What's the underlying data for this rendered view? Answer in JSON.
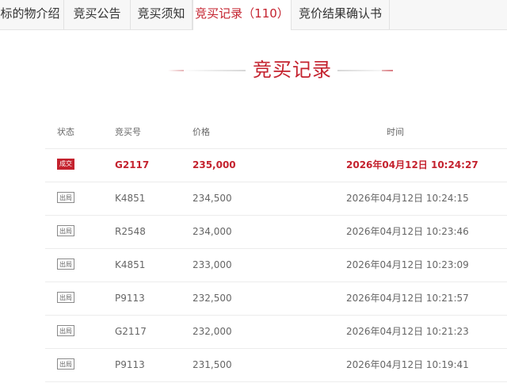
{
  "tabs": [
    {
      "label": "标的物介绍",
      "active": false
    },
    {
      "label": "竞买公告",
      "active": false
    },
    {
      "label": "竞买须知",
      "active": false
    },
    {
      "label": "竞买记录（110）",
      "active": true
    },
    {
      "label": "竞价结果确认书",
      "active": false
    }
  ],
  "section_title": "竞买记录",
  "table": {
    "headers": {
      "status": "状态",
      "code": "竞买号",
      "price": "价格",
      "time": "时间"
    },
    "rows": [
      {
        "status": "成交",
        "code": "G2117",
        "price": "235,000",
        "time": "2026年04月12日 10:24:27"
      },
      {
        "status": "出局",
        "code": "K4851",
        "price": "234,500",
        "time": "2026年04月12日 10:24:15"
      },
      {
        "status": "出局",
        "code": "R2548",
        "price": "234,000",
        "time": "2026年04月12日 10:23:46"
      },
      {
        "status": "出局",
        "code": "K4851",
        "price": "233,000",
        "time": "2026年04月12日 10:23:09"
      },
      {
        "status": "出局",
        "code": "P9113",
        "price": "232,500",
        "time": "2026年04月12日 10:21:57"
      },
      {
        "status": "出局",
        "code": "G2117",
        "price": "232,000",
        "time": "2026年04月12日 10:21:23"
      },
      {
        "status": "出局",
        "code": "P9113",
        "price": "231,500",
        "time": "2026年04月12日 10:19:41"
      }
    ]
  },
  "colors": {
    "accent": "#c4222e",
    "text": "#666666",
    "tab_bg": "#f7f7f7",
    "border": "#ececec"
  }
}
